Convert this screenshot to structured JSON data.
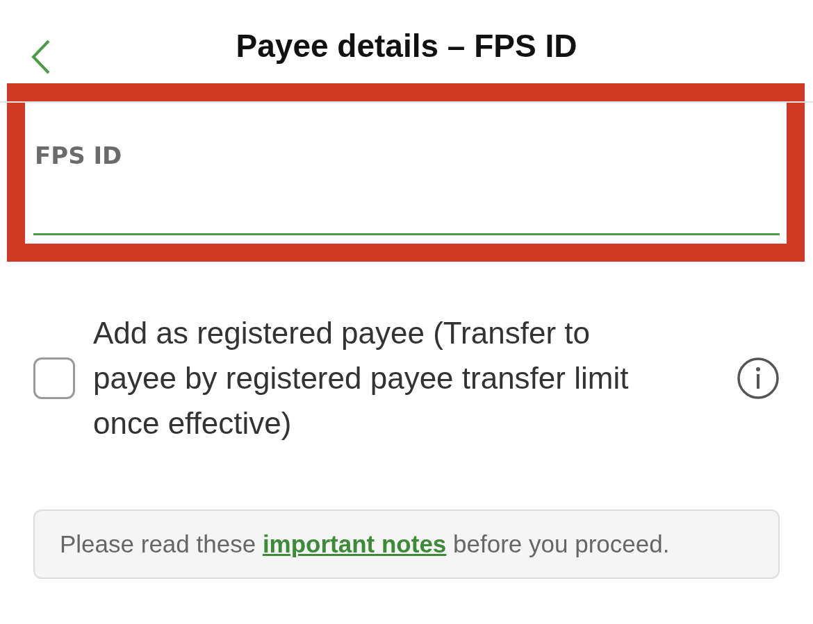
{
  "header": {
    "title": "Payee details – FPS ID"
  },
  "fps_field": {
    "placeholder": "FPS ID",
    "highlighted": true
  },
  "registered_payee": {
    "label": "Add as registered payee (Transfer to payee by registered payee transfer limit once effective)",
    "checked": false
  },
  "notes": {
    "before": "Please read these",
    "link": "important notes",
    "after": "before you proceed."
  }
}
